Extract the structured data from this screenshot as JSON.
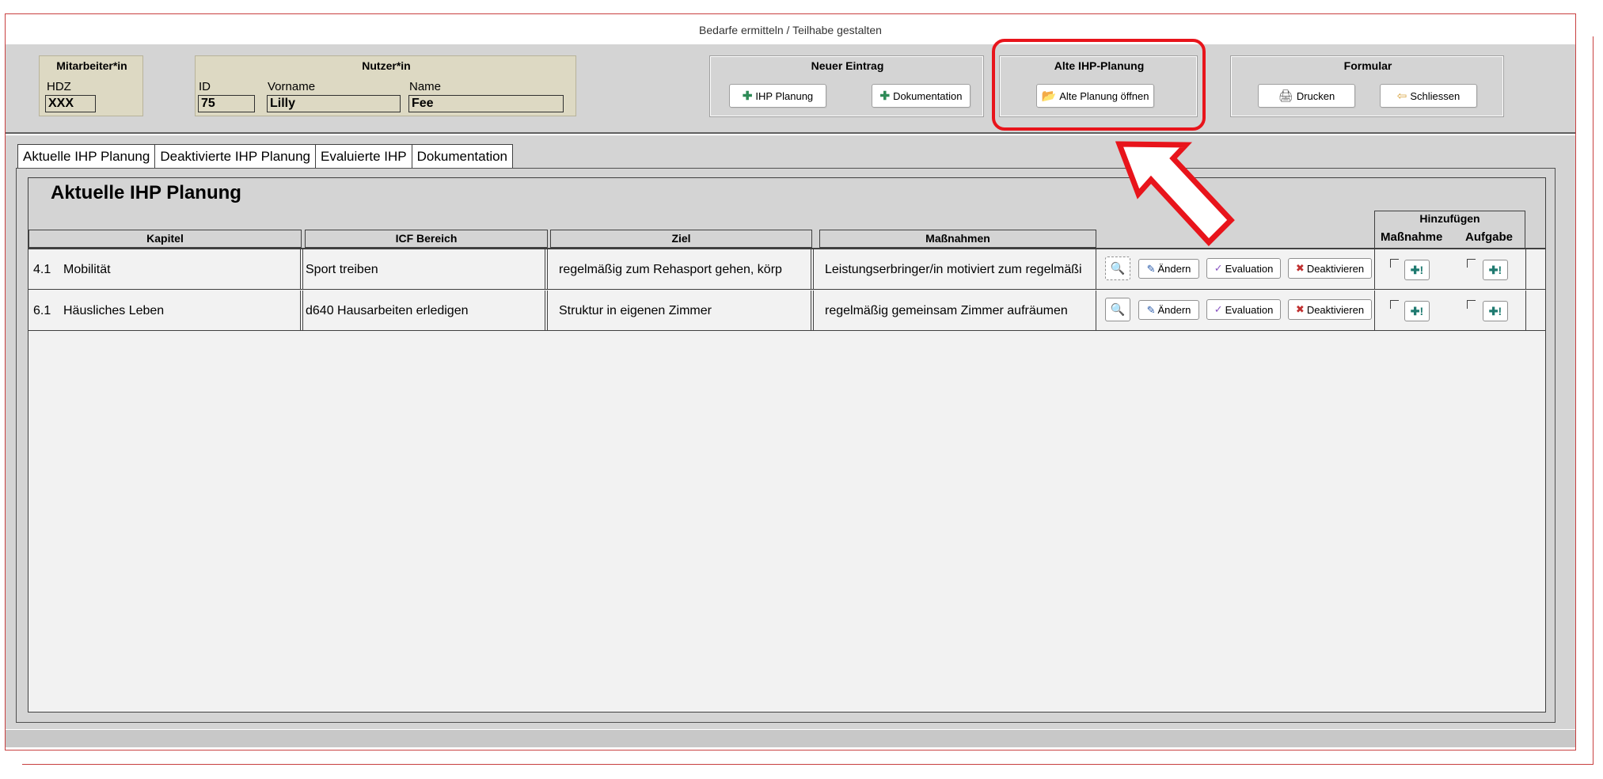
{
  "window": {
    "title": "Bedarfe ermitteln / Teilhabe gestalten"
  },
  "mitarbeiter": {
    "title": "Mitarbeiter*in",
    "label": "HDZ",
    "value": "XXX"
  },
  "nutzer": {
    "title": "Nutzer*in",
    "id_label": "ID",
    "id_value": "75",
    "vorname_label": "Vorname",
    "vorname_value": "Lilly",
    "name_label": "Name",
    "name_value": "Fee"
  },
  "neuer_eintrag": {
    "title": "Neuer Eintrag",
    "ihp_label": "IHP Planung",
    "doku_label": "Dokumentation"
  },
  "alte_ihp": {
    "title": "Alte IHP-Planung",
    "open_label": "Alte Planung öffnen"
  },
  "formular": {
    "title": "Formular",
    "print_label": "Drucken",
    "close_label": "Schliessen"
  },
  "tabs": [
    {
      "label": "Aktuelle IHP Planung"
    },
    {
      "label": "Deaktivierte IHP Planung"
    },
    {
      "label": "Evaluierte IHP"
    },
    {
      "label": "Dokumentation"
    }
  ],
  "section": {
    "title": "Aktuelle IHP Planung"
  },
  "columns": {
    "kapitel": "Kapitel",
    "icf": "ICF Bereich",
    "ziel": "Ziel",
    "massnahmen": "Maßnahmen",
    "hinzufuegen": "Hinzufügen",
    "massnahme": "Maßnahme",
    "aufgabe": "Aufgabe"
  },
  "row_actions": {
    "aendern": "Ändern",
    "evaluation": "Evaluation",
    "deaktivieren": "Deaktivieren"
  },
  "rows": [
    {
      "kapitel_num": "4.1",
      "kapitel": "Mobilität",
      "icf": "Sport treiben",
      "ziel": "regelmäßig zum Rehasport gehen, körp",
      "massnahmen": "Leistungserbringer/in motiviert zum regelmäßi"
    },
    {
      "kapitel_num": "6.1",
      "kapitel": "Häusliches Leben",
      "icf": "d640 Hausarbeiten erledigen",
      "ziel": "Struktur in eigenen Zimmer",
      "massnahmen": "regelmäßig gemeinsam Zimmer aufräumen"
    }
  ],
  "colors": {
    "highlight": "#e8141b",
    "beige_panel": "#ddd9c3",
    "background": "#d4d4d4"
  }
}
